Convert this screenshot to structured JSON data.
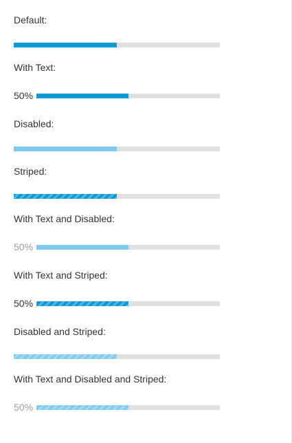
{
  "colors": {
    "accent": "#0b9ad7",
    "accent_disabled": "#82cbed",
    "track": "#e0e0e0",
    "text": "#333333",
    "text_disabled": "#9e9e9e"
  },
  "sections": [
    {
      "label": "Default:",
      "value": 0.5,
      "text": null,
      "disabled": false,
      "striped": false
    },
    {
      "label": "With Text:",
      "value": 0.5,
      "text": "50%",
      "disabled": false,
      "striped": false
    },
    {
      "label": "Disabled:",
      "value": 0.5,
      "text": null,
      "disabled": true,
      "striped": false
    },
    {
      "label": "Striped:",
      "value": 0.5,
      "text": null,
      "disabled": false,
      "striped": true
    },
    {
      "label": "With Text and Disabled:",
      "value": 0.5,
      "text": "50%",
      "disabled": true,
      "striped": false
    },
    {
      "label": "With Text and Striped:",
      "value": 0.5,
      "text": "50%",
      "disabled": false,
      "striped": true
    },
    {
      "label": "Disabled and Striped:",
      "value": 0.5,
      "text": null,
      "disabled": true,
      "striped": true
    },
    {
      "label": "With Text and Disabled and Striped:",
      "value": 0.5,
      "text": "50%",
      "disabled": true,
      "striped": true
    }
  ]
}
